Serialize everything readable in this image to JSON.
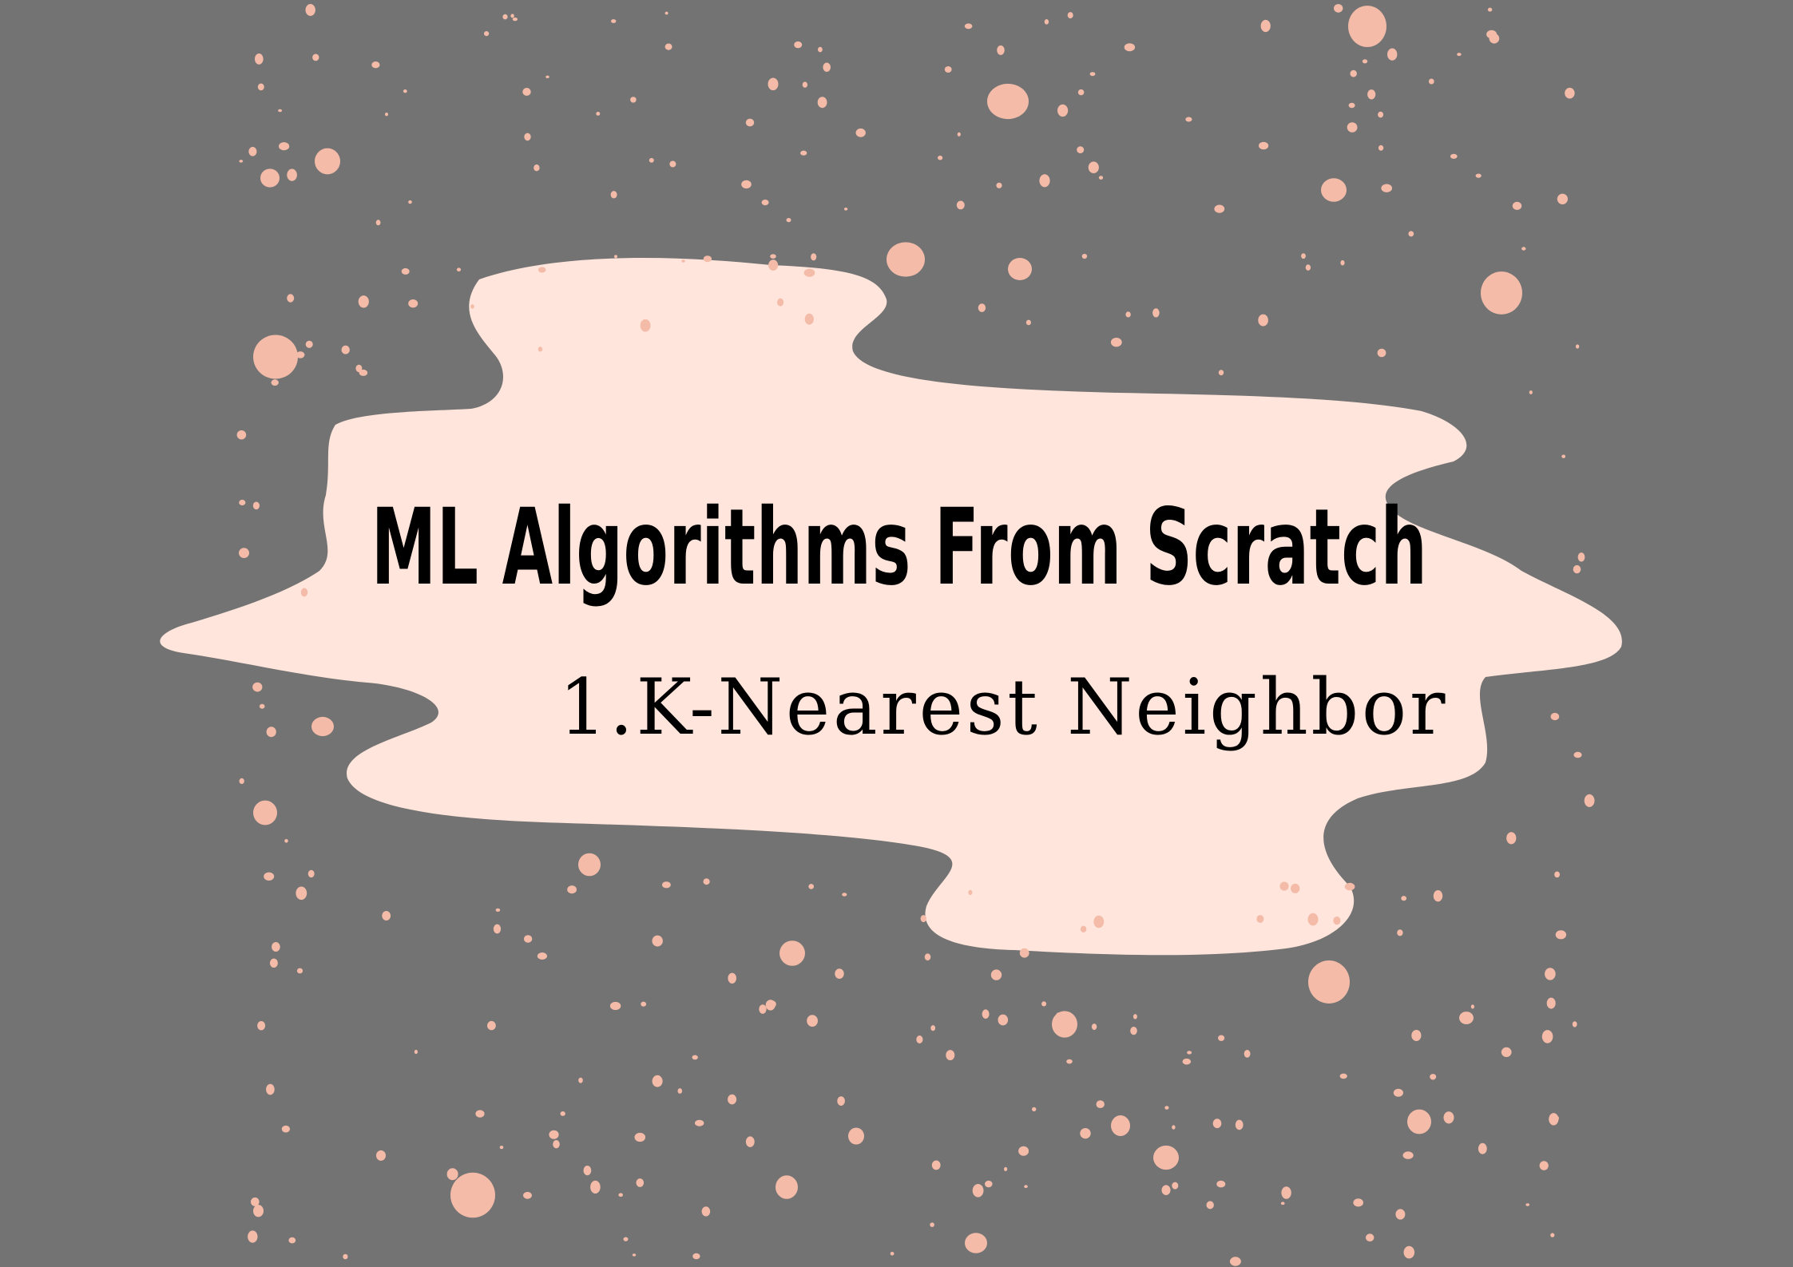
{
  "title": "ML Algorithms From Scratch",
  "subtitle": "1.K-Nearest Neighbor",
  "colors": {
    "background": "#737373",
    "blob": "#ffe5db",
    "dots": "#f3bba8",
    "text": "#000000"
  }
}
